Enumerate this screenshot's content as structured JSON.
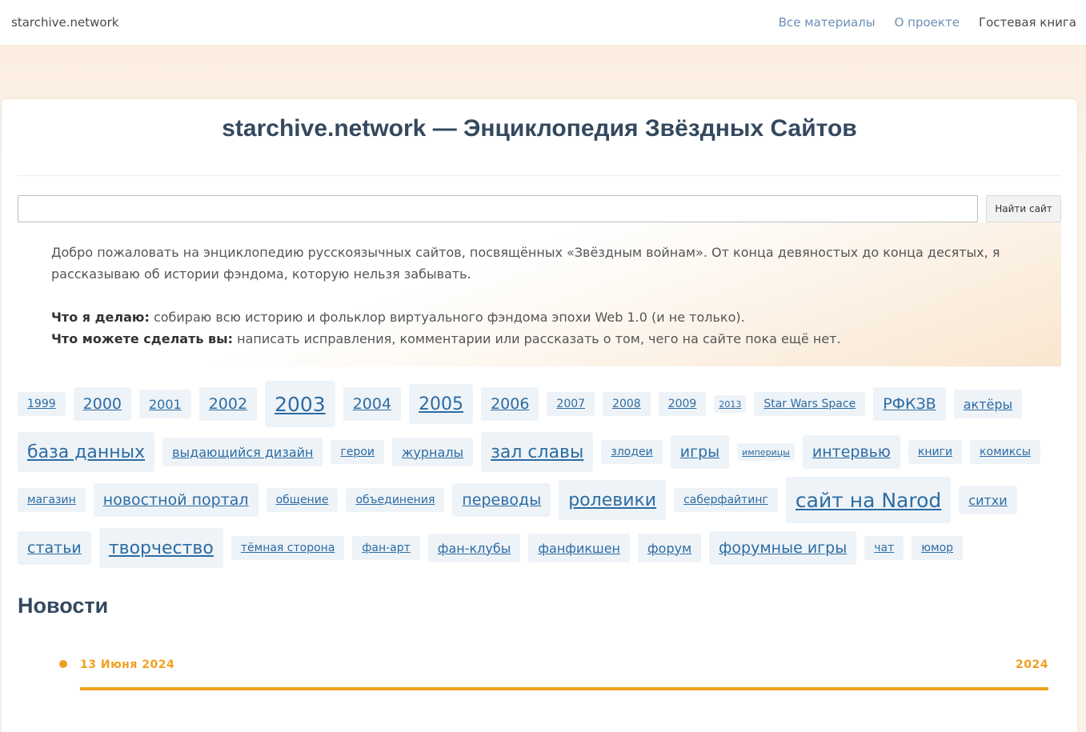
{
  "navbar": {
    "brand": "starchive.network",
    "links": [
      "Все материалы",
      "О проекте",
      "Гостевая книга"
    ]
  },
  "main": {
    "title": "starchive.network — Энциклопедия Звёздных Сайтов",
    "search": {
      "value": "",
      "placeholder": "",
      "button": "Найти сайт"
    },
    "intro": {
      "welcome": "Добро пожаловать на энциклопедию русскоязычных сайтов, посвящённых «Звёздным войнам». От конца девяностых до конца десятых, я рассказываю об истории фэндома, которую нельзя забывать.",
      "what_i_do_label": "Что я делаю:",
      "what_i_do": " собираю всю историю и фольклор виртуального фэндома эпохи Web 1.0 (и не только).",
      "what_you_do_label": "Что можете сделать вы:",
      "what_you_do": " написать исправления, комментарии или рассказать о том, чего на сайте пока ещё нет."
    },
    "tags": [
      {
        "label": "1999",
        "size": 2
      },
      {
        "label": "2000",
        "size": 4
      },
      {
        "label": "2001",
        "size": 3
      },
      {
        "label": "2002",
        "size": 4
      },
      {
        "label": "2003",
        "size": 6
      },
      {
        "label": "2004",
        "size": 4
      },
      {
        "label": "2005",
        "size": 5
      },
      {
        "label": "2006",
        "size": 4
      },
      {
        "label": "2007",
        "size": 2
      },
      {
        "label": "2008",
        "size": 2
      },
      {
        "label": "2009",
        "size": 2
      },
      {
        "label": "2013",
        "size": 1
      },
      {
        "label": "Star Wars Space",
        "size": 2
      },
      {
        "label": "РФКЗВ",
        "size": 4
      },
      {
        "label": "актёры",
        "size": 3
      },
      {
        "label": "база данных",
        "size": 5
      },
      {
        "label": "выдающийся дизайн",
        "size": 3
      },
      {
        "label": "герои",
        "size": 2
      },
      {
        "label": "журналы",
        "size": 3
      },
      {
        "label": "зал славы",
        "size": 5
      },
      {
        "label": "злодеи",
        "size": 2
      },
      {
        "label": "игры",
        "size": 4
      },
      {
        "label": "империцы",
        "size": 1
      },
      {
        "label": "интервью",
        "size": 4
      },
      {
        "label": "книги",
        "size": 2
      },
      {
        "label": "комиксы",
        "size": 2
      },
      {
        "label": "магазин",
        "size": 2
      },
      {
        "label": "новостной портал",
        "size": 4
      },
      {
        "label": "общение",
        "size": 2
      },
      {
        "label": "объединения",
        "size": 2
      },
      {
        "label": "переводы",
        "size": 4
      },
      {
        "label": "ролевики",
        "size": 5
      },
      {
        "label": "саберфайтинг",
        "size": 2
      },
      {
        "label": "сайт на Narod",
        "size": 6
      },
      {
        "label": "ситхи",
        "size": 3
      },
      {
        "label": "статьи",
        "size": 4
      },
      {
        "label": "творчество",
        "size": 5
      },
      {
        "label": "тёмная сторона",
        "size": 2
      },
      {
        "label": "фан-арт",
        "size": 2
      },
      {
        "label": "фан-клубы",
        "size": 3
      },
      {
        "label": "фанфикшен",
        "size": 3
      },
      {
        "label": "форум",
        "size": 3
      },
      {
        "label": "форумные игры",
        "size": 4
      },
      {
        "label": "чат",
        "size": 2
      },
      {
        "label": "юмор",
        "size": 2
      }
    ],
    "news": {
      "title": "Новости",
      "items": [
        {
          "date": "13 Июня 2024",
          "year": "2024"
        }
      ]
    }
  },
  "colors": {
    "accent": "#f0a020",
    "link": "#2d6ca2",
    "tag_bg": "#eef3f8",
    "title": "#34495e"
  }
}
